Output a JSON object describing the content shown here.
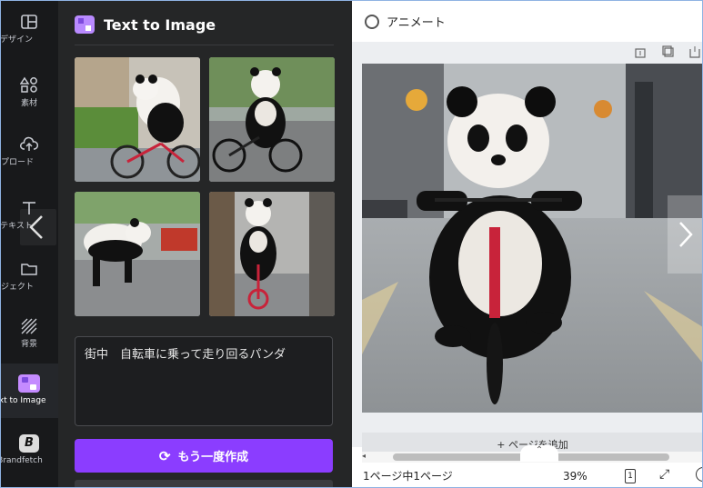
{
  "rail": {
    "items": [
      {
        "label": "デザイン"
      },
      {
        "label": "素材"
      },
      {
        "label": "アップロード"
      },
      {
        "label": "テキスト"
      },
      {
        "label": "プロジェクト"
      },
      {
        "label": "背景"
      },
      {
        "label": "Text to Image"
      },
      {
        "label": "Brandfetch"
      }
    ]
  },
  "panel": {
    "title": "Text to Image",
    "prompt": "街中　自転車に乗って走り回るパンダ",
    "generate_label": "もう一度作成"
  },
  "canvas": {
    "animate_label": "アニメート",
    "add_page_label": "+ ページを追加"
  },
  "status": {
    "pages": "1ページ中1ページ",
    "zoom": "39%",
    "page_count": "1"
  },
  "colors": {
    "accent": "#8b3dff",
    "panel_bg": "#252627",
    "rail_bg": "#18191b"
  }
}
